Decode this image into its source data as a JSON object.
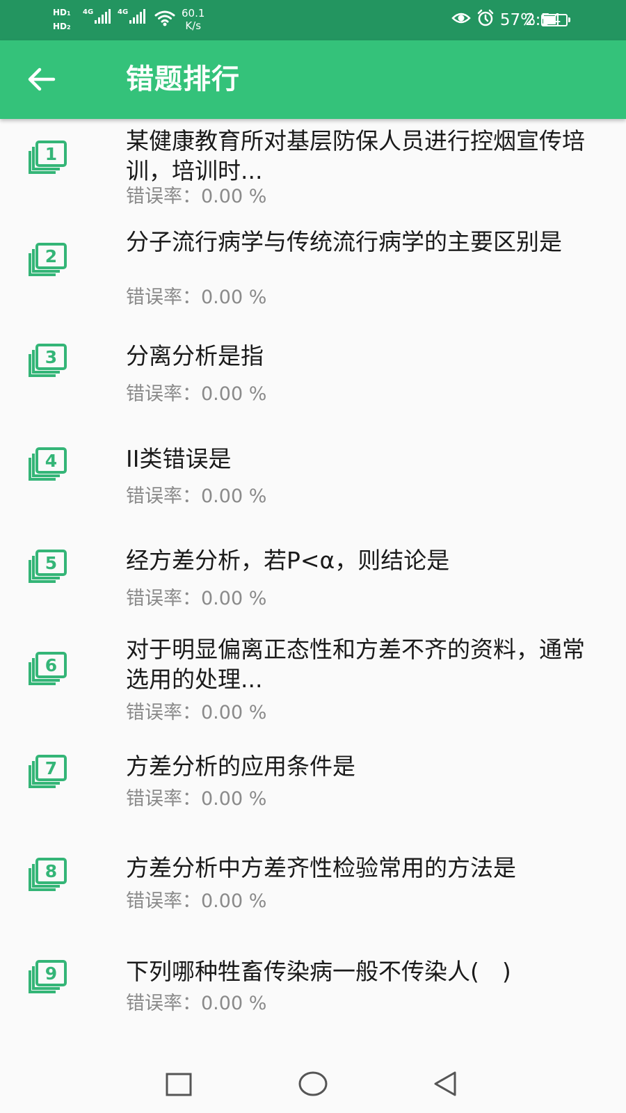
{
  "status_bar": {
    "hd1": "HD",
    "hd1_sub": "1",
    "hd2": "HD",
    "hd2_sub": "2",
    "sig1": "4G",
    "sig2": "4G",
    "net_speed_value": "60.1",
    "net_speed_unit": "K/s",
    "battery_percent": "57%",
    "battery_level": 0.57,
    "time": "2:54",
    "icons": [
      "eye-icon",
      "alarm-icon",
      "battery-icon",
      "wifi-icon",
      "signal-icon"
    ]
  },
  "app_bar": {
    "title": "错题排行",
    "back_icon": "arrow-left-icon"
  },
  "colors": {
    "status_bar": "#239560",
    "app_bar": "#34c27a",
    "accent": "#34b577",
    "question_text": "#1a1a1a",
    "rate_text": "#8a8a8a"
  },
  "items": [
    {
      "rank": "1",
      "question": "某健康教育所对基层防保人员进行控烟宣传培训，培训时...",
      "rate": "错误率：0.00 %"
    },
    {
      "rank": "2",
      "question": "分子流行病学与传统流行病学的主要区别是",
      "rate": "错误率：0.00 %"
    },
    {
      "rank": "3",
      "question": "分离分析是指",
      "rate": "错误率：0.00 %"
    },
    {
      "rank": "4",
      "question": "II类错误是",
      "rate": "错误率：0.00 %"
    },
    {
      "rank": "5",
      "question": "经方差分析，若P<α，则结论是",
      "rate": "错误率：0.00 %"
    },
    {
      "rank": "6",
      "question": "对于明显偏离正态性和方差不齐的资料，通常选用的处理...",
      "rate": "错误率：0.00 %"
    },
    {
      "rank": "7",
      "question": "方差分析的应用条件是",
      "rate": "错误率：0.00 %"
    },
    {
      "rank": "8",
      "question": "方差分析中方差齐性检验常用的方法是",
      "rate": "错误率：0.00 %"
    },
    {
      "rank": "9",
      "question": "下列哪种牲畜传染病一般不传染人(　)",
      "rate": "错误率：0.00 %"
    }
  ],
  "nav_bar": {
    "icons": [
      "recents-square-icon",
      "home-circle-icon",
      "back-triangle-icon"
    ]
  }
}
